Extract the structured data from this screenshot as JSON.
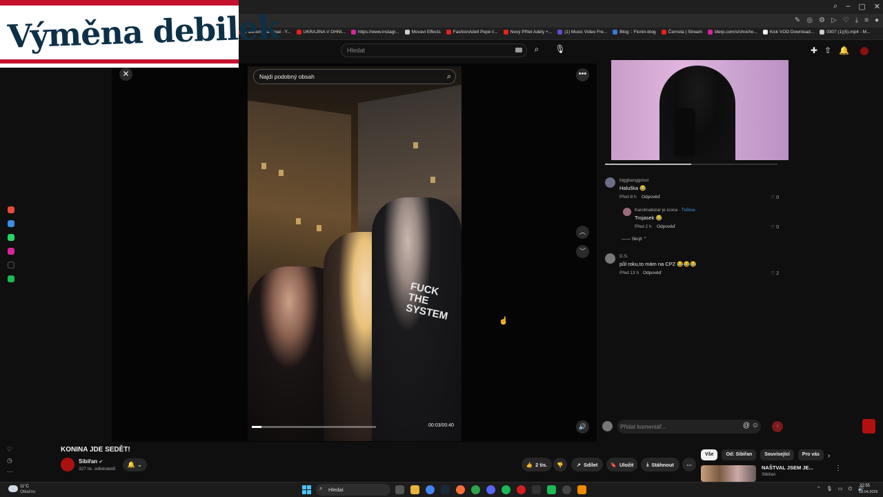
{
  "overlay": {
    "title": "Výměna debilek"
  },
  "browser": {
    "bookmarks": [
      {
        "label": "FashionAdellReal - Y...",
        "color": "#e62117"
      },
      {
        "label": "UKRAJINA V OHNI...",
        "color": "#e62117"
      },
      {
        "label": "https://www.instagr...",
        "color": "#d6249f"
      },
      {
        "label": "Movavi Effects",
        "color": "#cccccc"
      },
      {
        "label": "FashionAdell Pepé č...",
        "color": "#e62117"
      },
      {
        "label": "Nový Přítel Adély +...",
        "color": "#e62117"
      },
      {
        "label": "(1) Music Video Fre...",
        "color": "#5b4fd8"
      },
      {
        "label": "Blog :: Fionin-blog",
        "color": "#3a7bd5"
      },
      {
        "label": "Černota | Stream",
        "color": "#e62117"
      },
      {
        "label": "blerp.com/s/chocho...",
        "color": "#d6249f"
      },
      {
        "label": "Kick VOD Download...",
        "color": "#eeeeee"
      },
      {
        "label": "0307 (1)(5).mp4 - M...",
        "color": "#cccccc"
      }
    ]
  },
  "header": {
    "search_placeholder": "Hledat"
  },
  "player": {
    "video_search_placeholder": "Najdi podobný obsah",
    "shirt_text": "FUCK THE SYSTEM",
    "time": "00:03/00:40",
    "progress": 0.075,
    "live_bar_progress": 0.5
  },
  "comments": [
    {
      "user": "biggbanggrioci",
      "text": "Haluška 😂",
      "time": "Před 8 h",
      "reply": "Odpověď",
      "likes": "0",
      "avatar": "#6d6d8a"
    },
    {
      "user": "Karolinabizar je icona",
      "creator": "· Tvůrce",
      "text": "Trojasek 😂",
      "time": "Před 2 h",
      "reply": "Odpověď",
      "likes": "0",
      "avatar": "#9a6a7a"
    },
    {
      "user": "D.S.",
      "text": "půl roku,to mám na CPZ 😂😂😂",
      "time": "Před 13 h",
      "reply": "Odpověď",
      "likes": "2",
      "avatar": "#777777"
    }
  ],
  "comment_collapse": "Skrýt",
  "comment_box": {
    "placeholder": "Přidat komentář..."
  },
  "video": {
    "title": "KONINA JDE SEDĚT!",
    "channel": "Sibiřan",
    "subscribers": "327 tis. odběratelů",
    "likes": "2 tis.",
    "share": "Sdílet",
    "save": "Uložit",
    "download": "Stáhnout"
  },
  "chips": [
    "Vše",
    "Od: Sibiřan",
    "Související",
    "Pro vás"
  ],
  "recommended": {
    "title": "NAŠTVAL JSEM JE...",
    "channel": "Sibiřan"
  },
  "taskbar": {
    "temp": "11°C",
    "weather": "Oblačno",
    "search": "Hledat",
    "time": "22:55",
    "date": "18.04.2026"
  }
}
